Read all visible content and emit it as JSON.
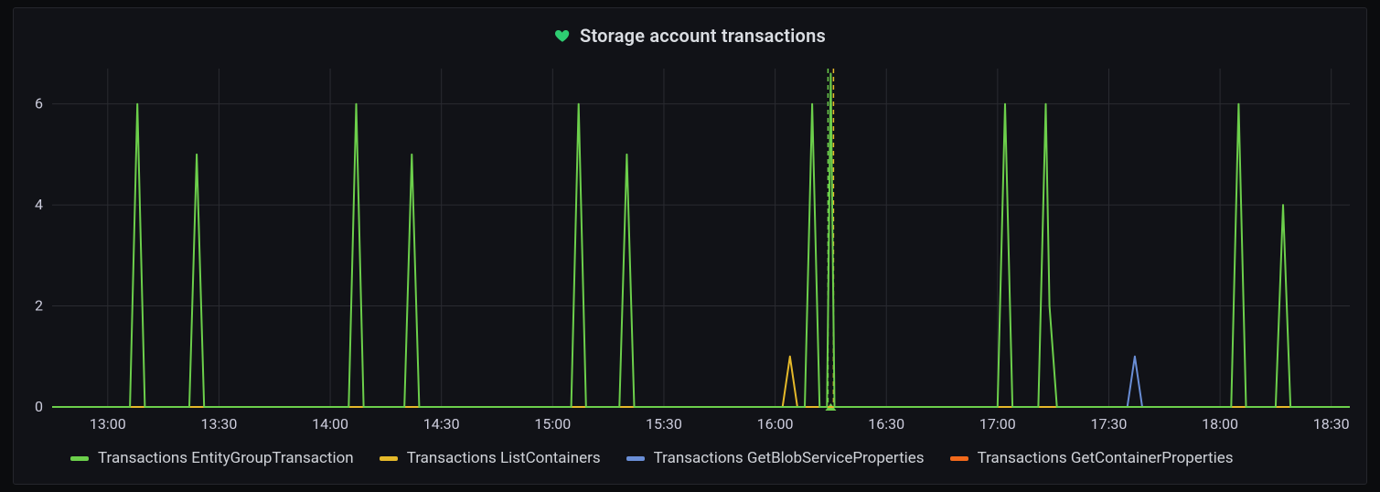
{
  "header": {
    "title": "Storage account transactions",
    "icon": "heart-icon",
    "icon_color": "#2ecc71"
  },
  "legend": [
    {
      "label": "Transactions EntityGroupTransaction",
      "color": "#6ccf4b"
    },
    {
      "label": "Transactions ListContainers",
      "color": "#e5b92a"
    },
    {
      "label": "Transactions GetBlobServiceProperties",
      "color": "#6a8ed6"
    },
    {
      "label": "Transactions GetContainerProperties",
      "color": "#f2691b"
    }
  ],
  "chart_data": {
    "type": "line",
    "title": "Storage account transactions",
    "xlabel": "",
    "ylabel": "",
    "x_type": "time",
    "x_range_minutes": [
      765,
      1115
    ],
    "x_ticks": [
      "13:00",
      "13:30",
      "14:00",
      "14:30",
      "15:00",
      "15:30",
      "16:00",
      "16:30",
      "17:00",
      "17:30",
      "18:00",
      "18:30"
    ],
    "ylim": [
      0,
      6.7
    ],
    "y_ticks": [
      0,
      2,
      4,
      6
    ],
    "grid": true,
    "legend_position": "bottom",
    "annotation_marker_minutes": 975,
    "series": [
      {
        "name": "Transactions EntityGroupTransaction",
        "color": "#6ccf4b",
        "points": [
          [
            765,
            0
          ],
          [
            786,
            0
          ],
          [
            788,
            6
          ],
          [
            790,
            0
          ],
          [
            802,
            0
          ],
          [
            804,
            5
          ],
          [
            806,
            0
          ],
          [
            845,
            0
          ],
          [
            847,
            6
          ],
          [
            849,
            0
          ],
          [
            860,
            0
          ],
          [
            862,
            5
          ],
          [
            864,
            0
          ],
          [
            905,
            0
          ],
          [
            907,
            6
          ],
          [
            909,
            0
          ],
          [
            918,
            0
          ],
          [
            920,
            5
          ],
          [
            922,
            0
          ],
          [
            968,
            0
          ],
          [
            970,
            6
          ],
          [
            972,
            0
          ],
          [
            974,
            0
          ],
          [
            975,
            6.6
          ],
          [
            976,
            0
          ],
          [
            1020,
            0
          ],
          [
            1022,
            6
          ],
          [
            1024,
            0
          ],
          [
            1031,
            0
          ],
          [
            1033,
            6
          ],
          [
            1034,
            2
          ],
          [
            1036,
            0
          ],
          [
            1083,
            0
          ],
          [
            1085,
            6
          ],
          [
            1087,
            0
          ],
          [
            1095,
            0
          ],
          [
            1097,
            4
          ],
          [
            1099,
            0
          ],
          [
            1115,
            0
          ]
        ]
      },
      {
        "name": "Transactions ListContainers",
        "color": "#e5b92a",
        "points": [
          [
            765,
            0
          ],
          [
            962,
            0
          ],
          [
            964,
            1
          ],
          [
            966,
            0
          ],
          [
            1115,
            0
          ]
        ]
      },
      {
        "name": "Transactions GetBlobServiceProperties",
        "color": "#6a8ed6",
        "points": [
          [
            765,
            0
          ],
          [
            1055,
            0
          ],
          [
            1057,
            1
          ],
          [
            1059,
            0
          ],
          [
            1115,
            0
          ]
        ]
      },
      {
        "name": "Transactions GetContainerProperties",
        "color": "#f2691b",
        "points": [
          [
            765,
            0
          ],
          [
            1115,
            0
          ]
        ]
      }
    ]
  }
}
